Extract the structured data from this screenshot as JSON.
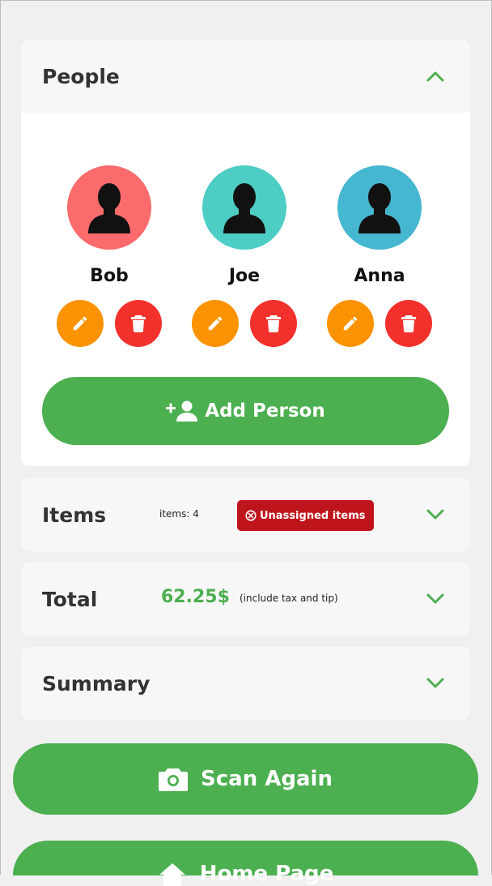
{
  "people_section": {
    "title": "People",
    "people": [
      {
        "name": "Bob",
        "color": "#fb6b6b"
      },
      {
        "name": "Joe",
        "color": "#4ecdc4"
      },
      {
        "name": "Anna",
        "color": "#45b7d1"
      }
    ],
    "add_label": "Add Person"
  },
  "items_section": {
    "title": "Items",
    "count_text": "items: 4",
    "badge_text": "Unassigned items"
  },
  "total_section": {
    "title": "Total",
    "amount": "62.25$",
    "note": "(include tax and tip)"
  },
  "summary_section": {
    "title": "Summary"
  },
  "buttons": {
    "scan_again": "Scan Again",
    "home_page": "Home Page"
  },
  "colors": {
    "accent_green": "#4caf50",
    "edit_orange": "#fb9200",
    "delete_red": "#f2302c",
    "badge_red": "#c0141c"
  },
  "icons": [
    "chevron-up-icon",
    "chevron-down-icon",
    "person-silhouette-icon",
    "pencil-icon",
    "trash-icon",
    "add-person-icon",
    "close-circle-icon",
    "camera-icon",
    "home-icon"
  ]
}
